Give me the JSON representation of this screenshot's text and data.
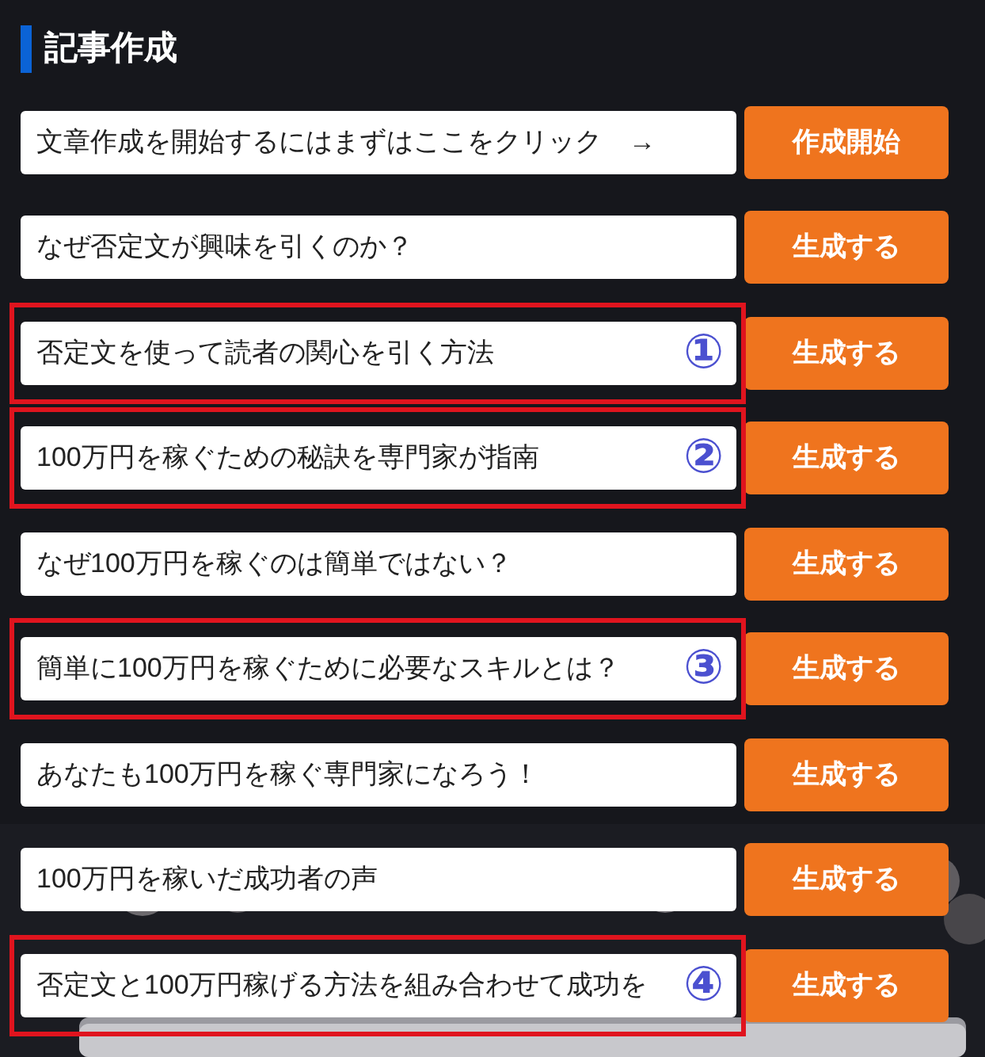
{
  "title": "記事作成",
  "rows": [
    {
      "value": "文章作成を開始するにはまずはここをクリック　→",
      "button": "作成開始"
    },
    {
      "value": "なぜ否定文が興味を引くのか？",
      "button": "生成する"
    },
    {
      "value": "否定文を使って読者の関心を引く方法",
      "button": "生成する",
      "marker": "①"
    },
    {
      "value": "100万円を稼ぐための秘訣を専門家が指南",
      "button": "生成する",
      "marker": "②"
    },
    {
      "value": "なぜ100万円を稼ぐのは簡単ではない？",
      "button": "生成する"
    },
    {
      "value": "簡単に100万円を稼ぐために必要なスキルとは？",
      "button": "生成する",
      "marker": "③"
    },
    {
      "value": "あなたも100万円を稼ぐ専門家になろう！",
      "button": "生成する"
    },
    {
      "value": "100万円を稼いだ成功者の声",
      "button": "生成する"
    },
    {
      "value": "否定文と100万円稼げる方法を組み合わせて成功を",
      "button": "生成する",
      "marker": "④"
    }
  ]
}
